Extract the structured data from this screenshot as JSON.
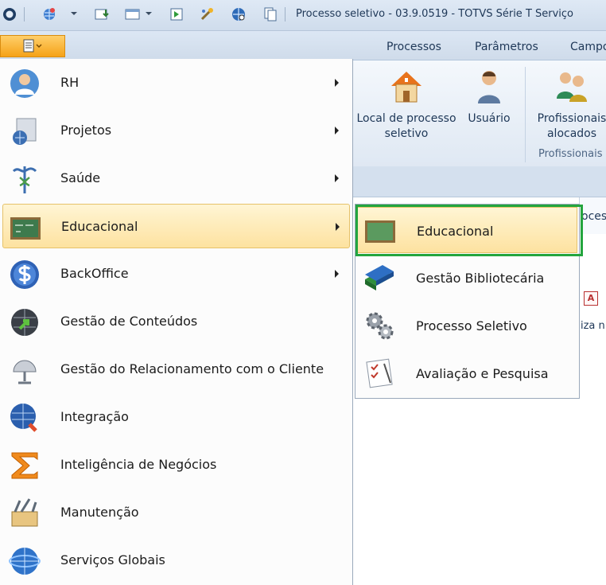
{
  "window": {
    "title": "Processo seletivo - 03.9.0519 - TOTVS Série T Serviço"
  },
  "ribbon": {
    "tabs": [
      "Processos",
      "Parâmetros",
      "Campo"
    ],
    "buttons": {
      "local": "Local de processo seletivo",
      "usuario": "Usuário",
      "profissionais": "Profissionais alocados"
    },
    "group_label": "Profissionais"
  },
  "document": {
    "tab_fragment": "oces",
    "text_fragment": "iza n"
  },
  "menu": {
    "items": [
      {
        "label": "RH",
        "icon": "person-icon",
        "submenu": true
      },
      {
        "label": "Projetos",
        "icon": "projects-icon",
        "submenu": true
      },
      {
        "label": "Saúde",
        "icon": "caduceus-icon",
        "submenu": true
      },
      {
        "label": "Educacional",
        "icon": "chalkboard-icon",
        "submenu": true
      },
      {
        "label": "BackOffice",
        "icon": "dollar-icon",
        "submenu": true
      },
      {
        "label": "Gestão de Conteúdos",
        "icon": "globe-arrow-icon",
        "submenu": false
      },
      {
        "label": "Gestão do Relacionamento com o Cliente",
        "icon": "satellite-dish-icon",
        "submenu": false
      },
      {
        "label": "Integração",
        "icon": "globe-plug-icon",
        "submenu": false
      },
      {
        "label": "Inteligência de Negócios",
        "icon": "sigma-icon",
        "submenu": false
      },
      {
        "label": "Manutenção",
        "icon": "toolbox-icon",
        "submenu": false
      },
      {
        "label": "Serviços Globais",
        "icon": "globe-icon",
        "submenu": false
      }
    ]
  },
  "submenu": {
    "items": [
      {
        "label": "Educacional",
        "icon": "chalkboard-icon"
      },
      {
        "label": "Gestão Bibliotecária",
        "icon": "books-icon"
      },
      {
        "label": "Processo Seletivo",
        "icon": "gears-icon"
      },
      {
        "label": "Avaliação e Pesquisa",
        "icon": "checklist-icon"
      }
    ]
  },
  "colors": {
    "highlight_border": "#24a53e",
    "selection": "#fde2a0",
    "app_button": "#f5a218"
  }
}
